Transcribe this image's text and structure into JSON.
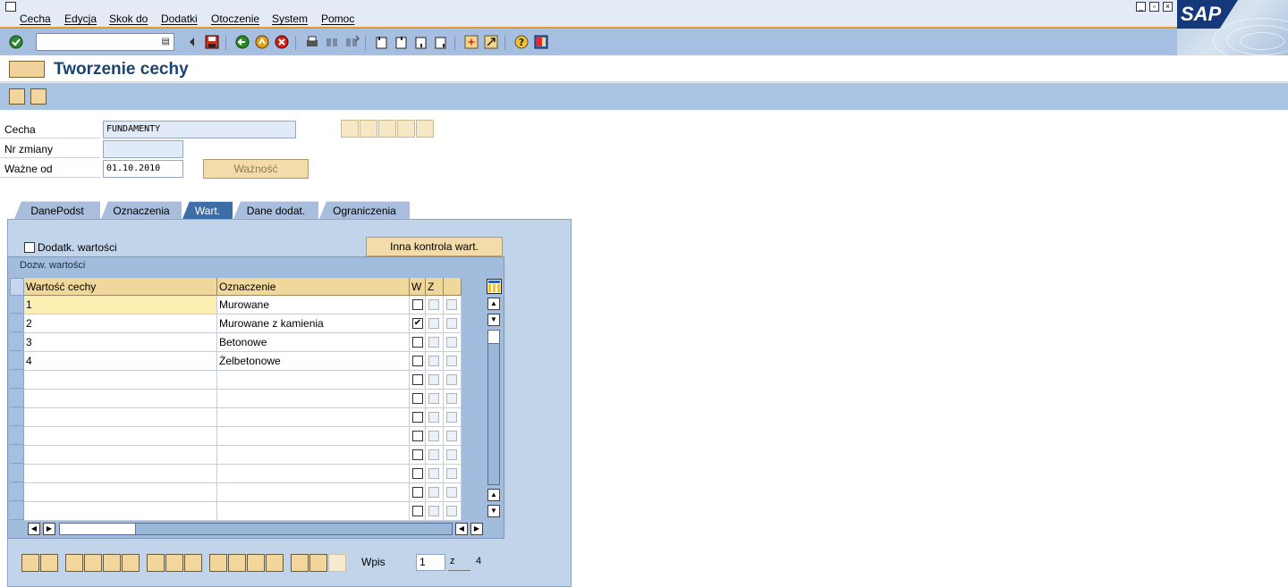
{
  "menu": {
    "items": [
      "Cecha",
      "Edycja",
      "Skok do",
      "Dodatki",
      "Otoczenie",
      "System",
      "Pomoc"
    ]
  },
  "brand": {
    "logo_text": "SAP"
  },
  "toolbar": {
    "command_value": "",
    "icons": [
      "enter-icon",
      "save-icon",
      "back-icon",
      "exit-icon",
      "cancel-icon",
      "print-icon",
      "find-icon",
      "find-next-icon",
      "first-page-icon",
      "previous-page-icon",
      "next-page-icon",
      "last-page-icon",
      "create-session-icon",
      "shortcut-icon",
      "help-icon",
      "layout-icon"
    ]
  },
  "title": {
    "text": "Tworzenie cechy"
  },
  "form": {
    "cecha_label": "Cecha",
    "cecha_value": "FUNDAMENTY",
    "nr_zmiany_label": "Nr zmiany",
    "nr_zmiany_value": "",
    "wazne_od_label": "Ważne od",
    "wazne_od_value": "01.10.2010",
    "waznosc_button": "Ważność"
  },
  "tabs": [
    {
      "label": "DanePodst",
      "active": false
    },
    {
      "label": "Oznaczenia",
      "active": false
    },
    {
      "label": "Wart.",
      "active": true
    },
    {
      "label": "Dane dodat.",
      "active": false
    },
    {
      "label": "Ograniczenia",
      "active": false
    }
  ],
  "panel": {
    "dodatk_label": "Dodatk. wartości",
    "dodatk_checked": false,
    "inna_kontrola_button": "Inna kontrola wart.",
    "table_title": "Dozw. wartości",
    "columns": [
      "Wartość cechy",
      "Oznaczenie",
      "W",
      "Z",
      ""
    ],
    "rows": [
      {
        "value": "1",
        "desc": "Murowane",
        "w": false
      },
      {
        "value": "2",
        "desc": "Murowane z kamienia",
        "w": true
      },
      {
        "value": "3",
        "desc": "Betonowe",
        "w": false
      },
      {
        "value": "4",
        "desc": "Żelbetonowe",
        "w": false
      },
      {
        "value": "",
        "desc": "",
        "w": false
      },
      {
        "value": "",
        "desc": "",
        "w": false
      },
      {
        "value": "",
        "desc": "",
        "w": false
      },
      {
        "value": "",
        "desc": "",
        "w": false
      },
      {
        "value": "",
        "desc": "",
        "w": false
      },
      {
        "value": "",
        "desc": "",
        "w": false
      },
      {
        "value": "",
        "desc": "",
        "w": false
      },
      {
        "value": "",
        "desc": "",
        "w": false
      }
    ]
  },
  "footer": {
    "wpis_label": "Wpis",
    "wpis_value": "1",
    "z_label": "z",
    "total": "4"
  }
}
